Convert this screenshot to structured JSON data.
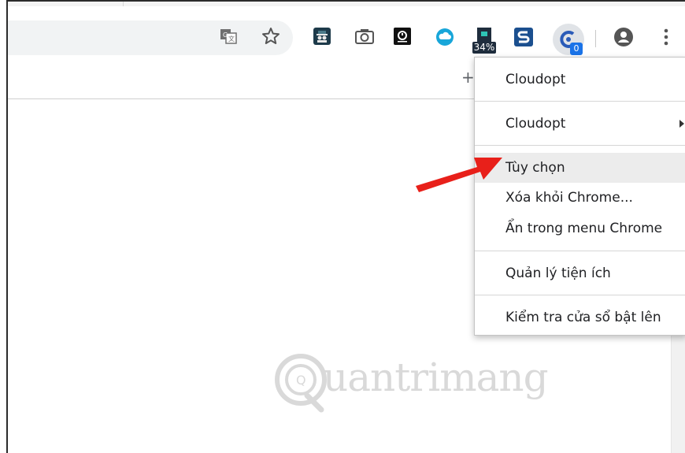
{
  "toolbar": {
    "icons": [
      "translate-icon",
      "star-icon",
      "extension-icon",
      "camera-icon",
      "extension-icon",
      "cloud-icon",
      "extension-icon",
      "extension-icon",
      "cloudopt-icon",
      "profile-icon",
      "more-icon"
    ],
    "badge_percent": "34%",
    "cloudopt_badge": "0"
  },
  "bookmarks_bar": {
    "plus": "+"
  },
  "context_menu": {
    "items": [
      {
        "label": "Cloudopt"
      },
      {
        "label": "Cloudopt",
        "has_submenu": true
      },
      {
        "label": "Tùy chọn",
        "highlighted": true
      },
      {
        "label": "Xóa khỏi Chrome..."
      },
      {
        "label": "Ẩn trong menu Chrome"
      },
      {
        "label": "Quản lý tiện ích"
      },
      {
        "label": "Kiểm tra cửa sổ bật lên"
      }
    ]
  },
  "annotation": {
    "arrow_color": "#e8201a"
  },
  "watermark": {
    "text": "uantrimang",
    "mark": "Q"
  }
}
